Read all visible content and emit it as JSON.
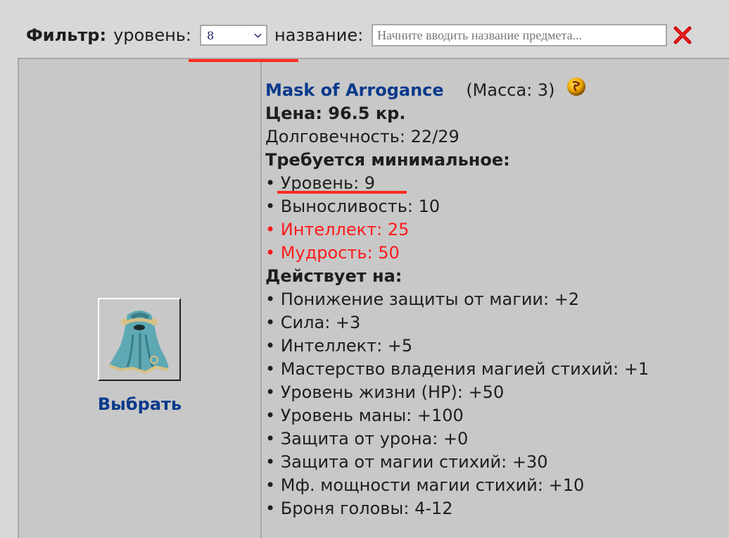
{
  "filter": {
    "title": "Фильтр:",
    "level_label": "уровень:",
    "level_value": "8",
    "name_label": "название:",
    "name_value": "",
    "name_placeholder": "Начните вводить название предмета...",
    "clear_icon": "close-x-icon"
  },
  "item": {
    "image_alt": "Mask of Arrogance",
    "select_label": "Выбрать",
    "name": "Mask of Arrogance",
    "mass": "(Масса: 3)",
    "artefact_icon": "artefact-orb-icon",
    "price": "Цена: 96.5 кр.",
    "durability": "Долговечность: 22/29",
    "requirements_title": "Требуется минимальное:",
    "requirements": [
      {
        "text": "Уровень: 9",
        "unmet": false
      },
      {
        "text": "Выносливость: 10",
        "unmet": false
      },
      {
        "text": "Интеллект: 25",
        "unmet": true
      },
      {
        "text": "Мудрость: 50",
        "unmet": true
      }
    ],
    "effects_title": "Действует на:",
    "effects": [
      "Понижение защиты от магии: +2",
      "Сила: +3",
      "Интеллект: +5",
      "Мастерство владения магией стихий: +1",
      "Уровень жизни (HP): +50",
      "Уровень маны: +100",
      "Защита от урона: +0",
      "Защита от магии стихий: +30",
      "Мф. мощности магии стихий: +10",
      "Броня головы: 4-12"
    ]
  },
  "colors": {
    "link": "#0a3a8c",
    "unmet_requirement": "#ff1a1a",
    "annotation_underline": "#ff2a1f"
  }
}
